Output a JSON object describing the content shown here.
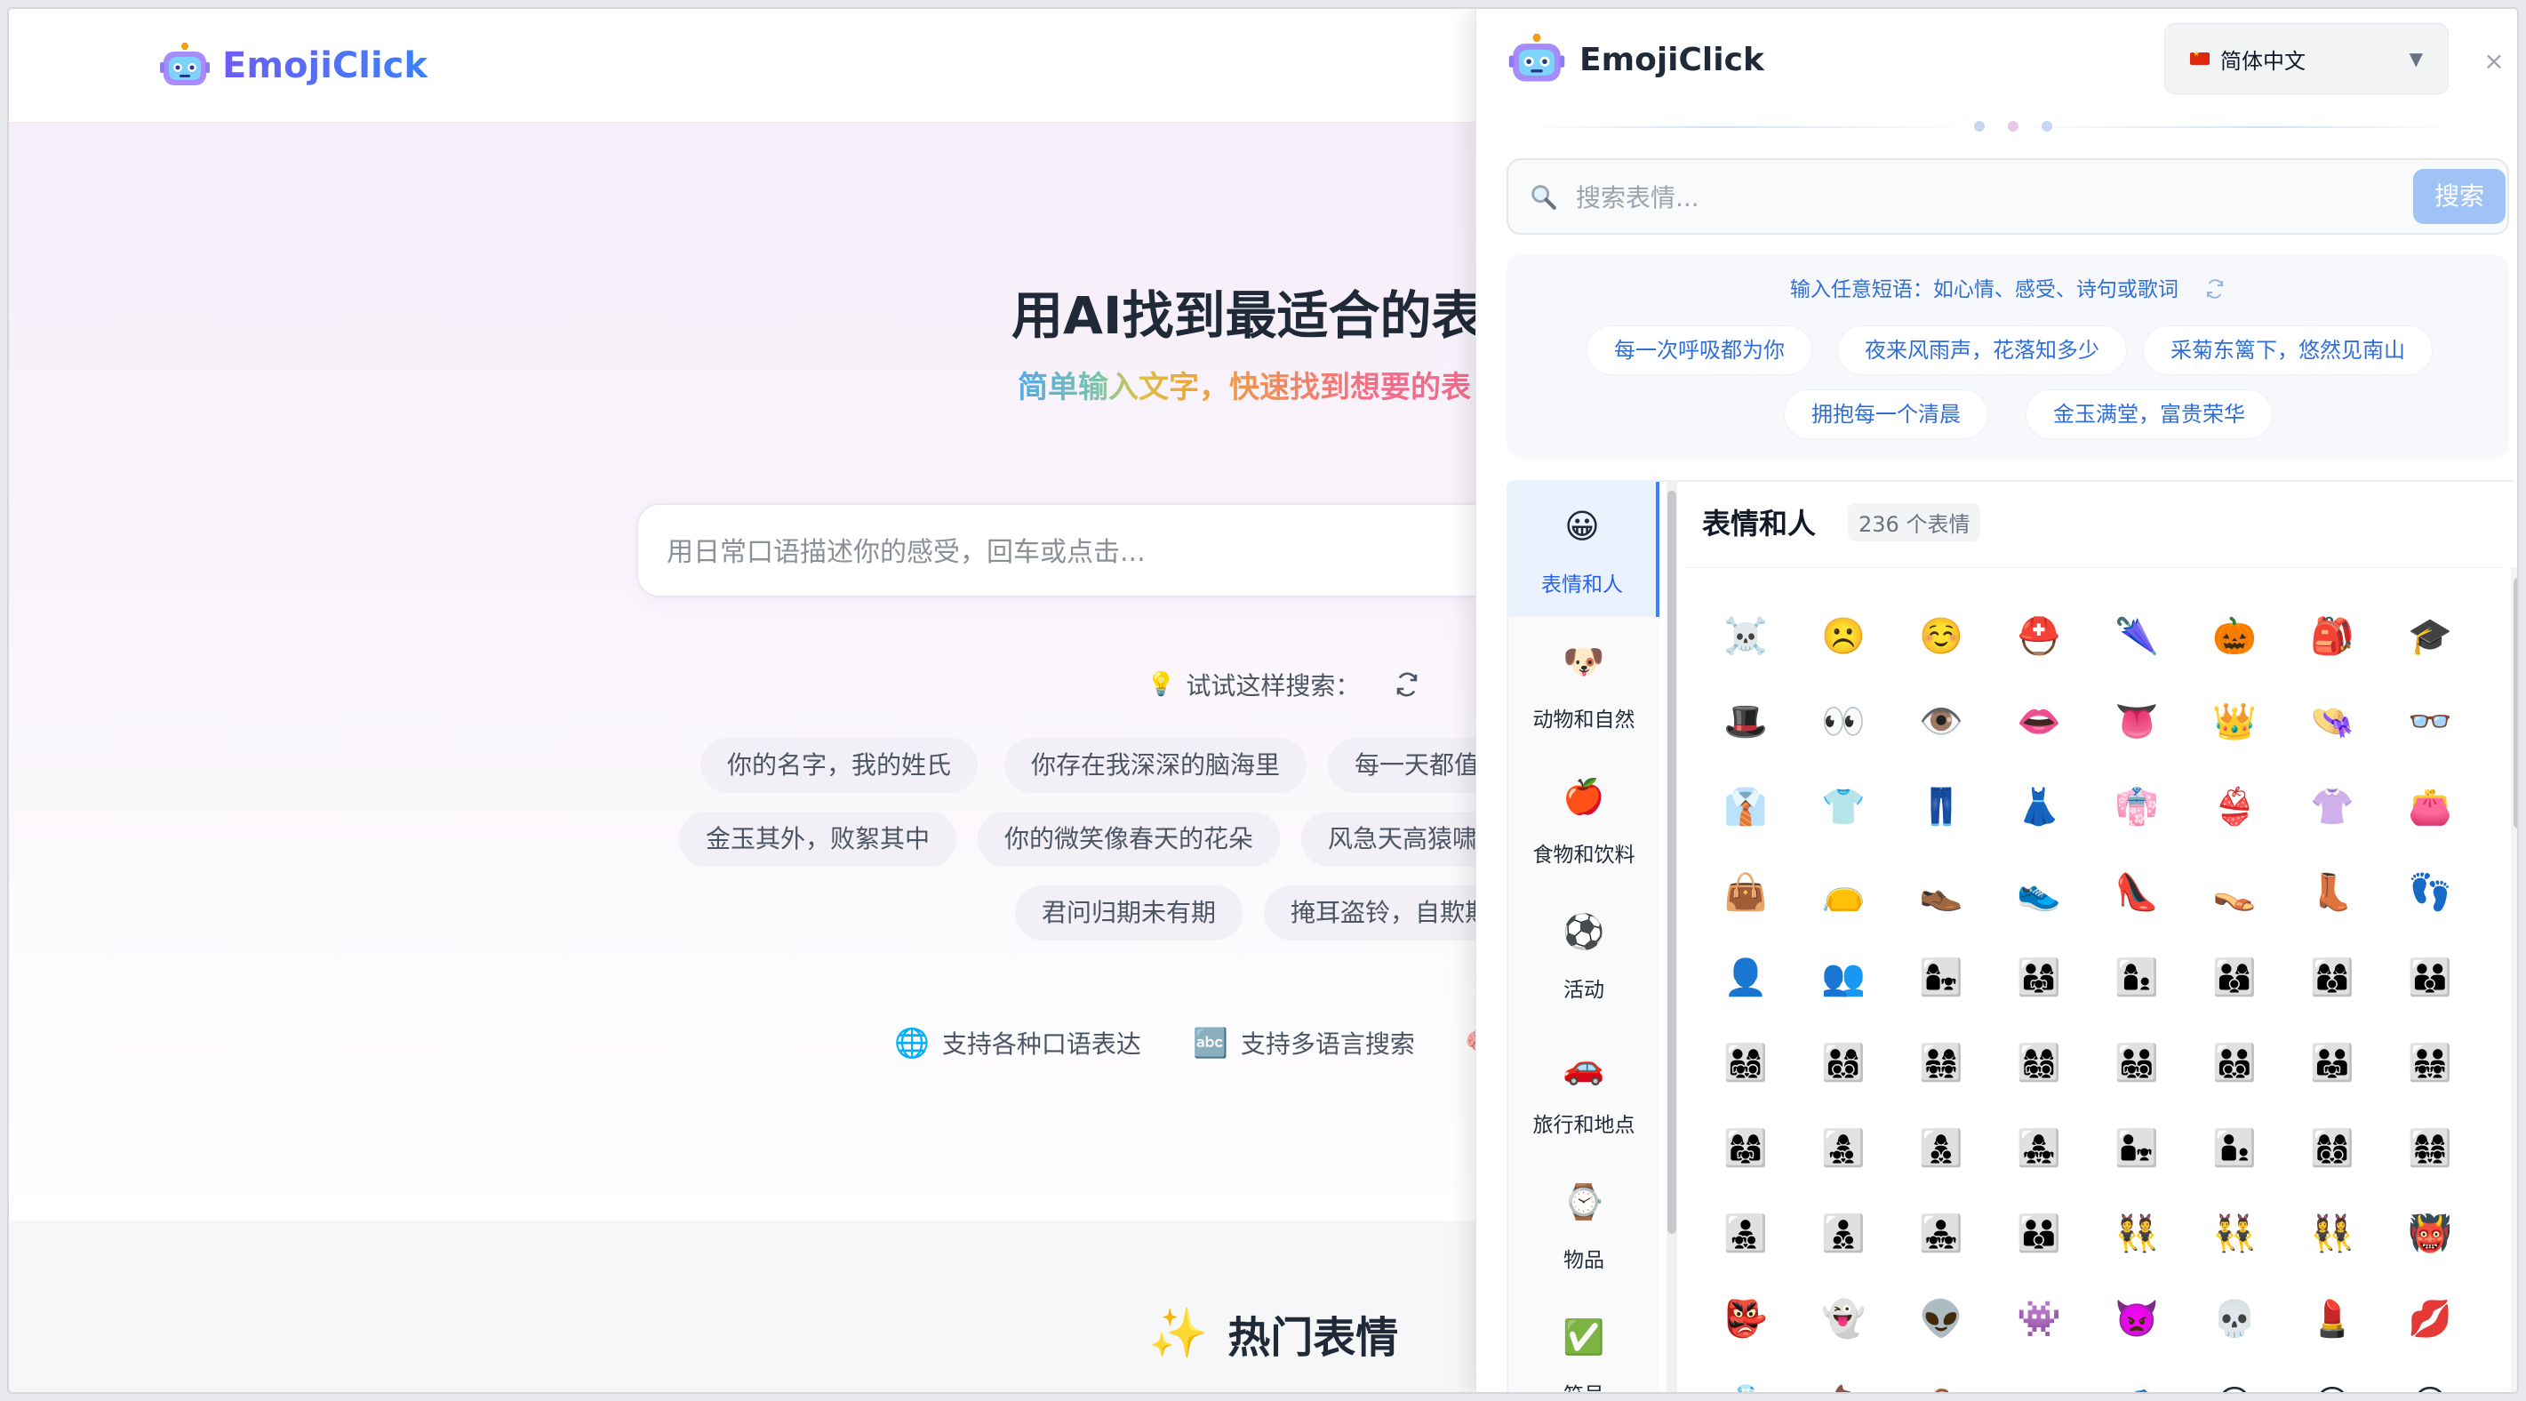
{
  "bg": {
    "logo_text": "EmojiClick",
    "hero_title": "用AI找到最适合的表",
    "hero_sub": "简单输入文字，快速找到想要的表",
    "search_placeholder": "用日常口语描述你的感受，回车或点击...",
    "try_label": "试试这样搜索：",
    "chips": [
      "你的名字，我的姓氏",
      "你存在我深深的脑海里",
      "每一天都值得",
      "金玉其外，败絮其中",
      "你的微笑像春天的花朵",
      "风急天高猿啸哀",
      "君问归期未有期",
      "掩耳盗铃，自欺欺人"
    ],
    "features": [
      {
        "icon": "🌐",
        "label": "支持各种口语表达"
      },
      {
        "icon": "🔤",
        "label": "支持多语言搜索"
      },
      {
        "icon": "🧠",
        "label": ""
      }
    ],
    "hot_icon": "✨",
    "hot_title": "热门表情"
  },
  "panel": {
    "logo_text": "EmojiClick",
    "language": "简体中文",
    "close": "×",
    "search_placeholder": "搜索表情...",
    "search_button": "搜索",
    "suggest_head": "输入任意短语：如心情、感受、诗句或歌词",
    "suggestions": [
      "每一次呼吸都为你",
      "夜来风雨声，花落知多少",
      "采菊东篱下，悠然见南山",
      "拥抱每一个清晨",
      "金玉满堂，富贵荣华"
    ],
    "categories": [
      {
        "icon": "😀",
        "label": "表情和人"
      },
      {
        "icon": "🐶",
        "label": "动物和自然"
      },
      {
        "icon": "🍎",
        "label": "食物和饮料"
      },
      {
        "icon": "⚽",
        "label": "活动"
      },
      {
        "icon": "🚗",
        "label": "旅行和地点"
      },
      {
        "icon": "⌚",
        "label": "物品"
      },
      {
        "icon": "✅",
        "label": "符号"
      }
    ],
    "grid_title": "表情和人",
    "grid_count": "236 个表情",
    "emojis": [
      "☠️",
      "☹️",
      "☺️",
      "⛑️",
      "🌂",
      "🎃",
      "🎒",
      "🎓",
      "🎩",
      "👀",
      "👁️",
      "👄",
      "👅",
      "👑",
      "👒",
      "👓",
      "👔",
      "👕",
      "👖",
      "👗",
      "👘",
      "👙",
      "👚",
      "👛",
      "👜",
      "👝",
      "👞",
      "👟",
      "👠",
      "👡",
      "👢",
      "👣",
      "👤",
      "👥",
      "👩‍👧",
      "👨‍👩‍👧",
      "👩‍👦",
      "👨‍👩‍👦",
      "👩‍👩‍👦",
      "👨‍👨‍👦",
      "👨‍👩‍👧‍👦",
      "👨‍👩‍👦‍👦",
      "👨‍👩‍👧‍👧",
      "👩‍👩‍👧‍👦",
      "👨‍👨‍👧‍👦",
      "👨‍👨‍👦‍👦",
      "👨‍👨‍👧",
      "👨‍👨‍👧‍👧",
      "👩‍👩‍👧",
      "👩‍👧‍👦",
      "👩‍👦‍👦",
      "👩‍👧‍👧",
      "👨‍👧",
      "👨‍👦",
      "👩‍👩‍👦‍👦",
      "👩‍👩‍👧‍👧",
      "👨‍👧‍👦",
      "👨‍👦‍👦",
      "👨‍👧‍👧",
      "👪",
      "👯",
      "👯‍♂️",
      "👯‍♀️",
      "👹",
      "👺",
      "👻",
      "👽",
      "👾",
      "👿",
      "💀",
      "💄",
      "💋",
      "💍",
      "💩",
      "💼",
      "🕶️",
      "🧢",
      "😀",
      "😁",
      "😂"
    ]
  }
}
